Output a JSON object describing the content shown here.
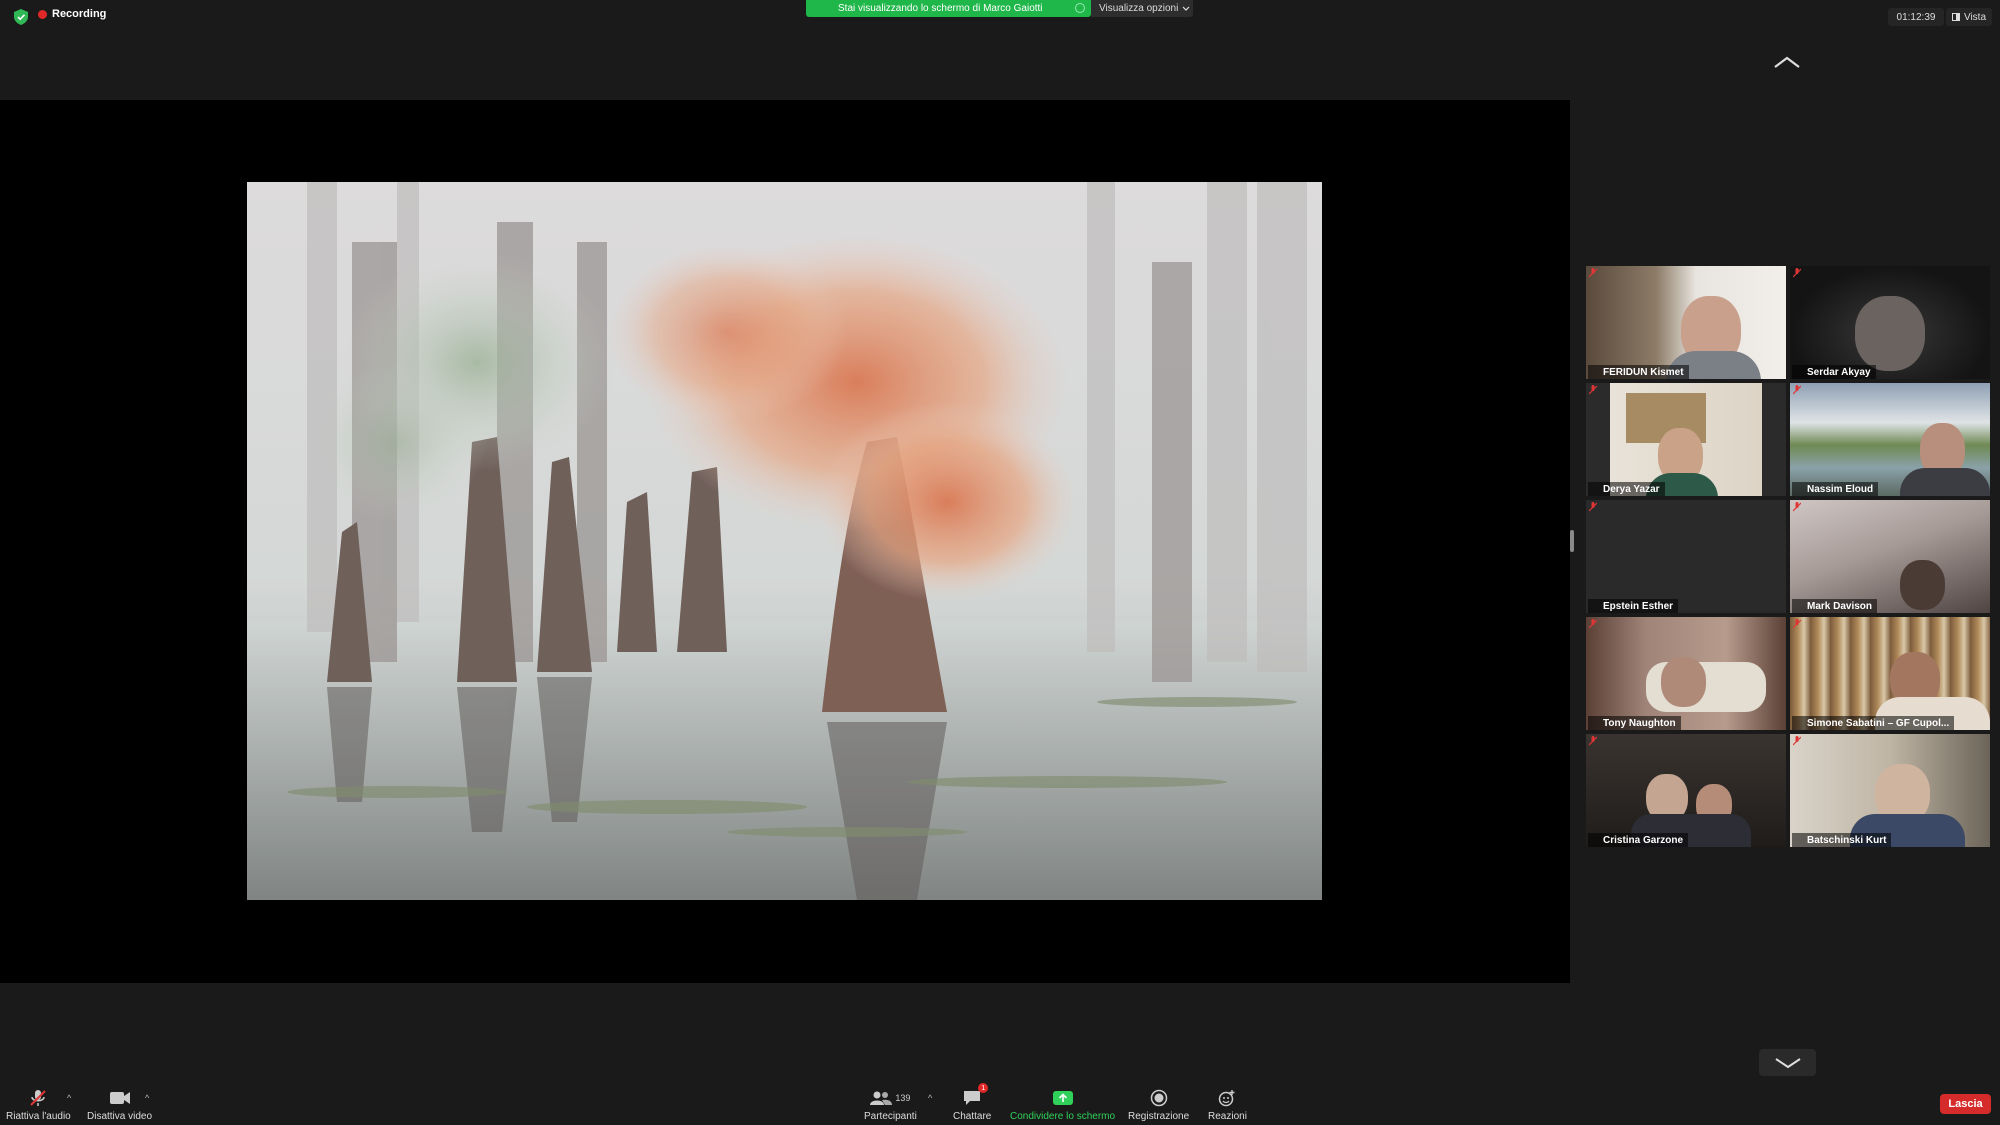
{
  "recording": {
    "label": "Recording"
  },
  "share_banner": {
    "text": "Stai visualizzando lo schermo di Marco Gaiotti"
  },
  "view_options": {
    "label": "Visualizza opzioni"
  },
  "meeting_timer": {
    "value": "01:12:39"
  },
  "view_button": {
    "label": "Vista"
  },
  "participants_tiles": [
    {
      "name": "FERIDUN Kismet"
    },
    {
      "name": "Serdar Akyay"
    },
    {
      "name": "Derya Yazar"
    },
    {
      "name": "Nassim Eloud"
    },
    {
      "name": "Epstein Esther"
    },
    {
      "name": "Mark Davison"
    },
    {
      "name": "Tony Naughton"
    },
    {
      "name": "Simone Sabatini – GF Cupol..."
    },
    {
      "name": "Cristina Garzone"
    },
    {
      "name": "Batschinski Kurt"
    }
  ],
  "toolbar": {
    "unmute_label": "Riattiva l'audio",
    "stop_video_label": "Disattiva video",
    "participants_label": "Partecipanti",
    "participants_count": "139",
    "chat_label": "Chattare",
    "chat_badge": "1",
    "share_screen_label": "Condividere lo schermo",
    "record_label": "Registrazione",
    "reactions_label": "Reazioni",
    "leave_label": "Lascia"
  },
  "colors": {
    "share_green": "#20b74a",
    "leave_red": "#d62b2b",
    "record_red": "#e02828",
    "background": "#1a1a1a"
  },
  "icons": [
    "shield-icon",
    "record-dot-icon",
    "chevron-down-icon",
    "view-icon",
    "chevron-up-icon",
    "muted-mic-icon",
    "video-camera-icon",
    "participants-icon",
    "chat-icon",
    "share-screen-icon",
    "record-icon",
    "reactions-icon"
  ]
}
